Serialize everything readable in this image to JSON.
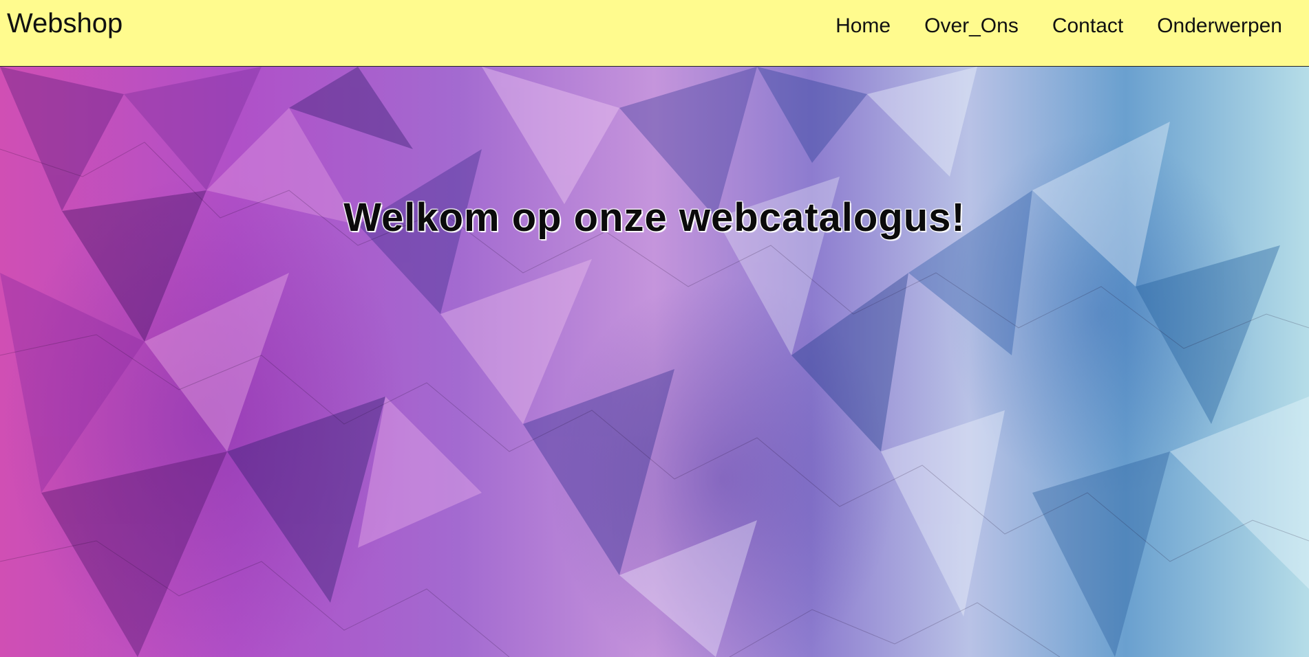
{
  "header": {
    "brand": "Webshop",
    "nav": [
      {
        "label": "Home"
      },
      {
        "label": "Over_Ons"
      },
      {
        "label": "Contact"
      },
      {
        "label": "Onderwerpen"
      }
    ],
    "background_color": "#fffb8e"
  },
  "hero": {
    "headline": "Welkom op onze webcatalogus!",
    "background_description_colors": [
      "#d04fb4",
      "#a36ad0",
      "#c595dc",
      "#6aa0cf",
      "#b6dde8"
    ]
  }
}
